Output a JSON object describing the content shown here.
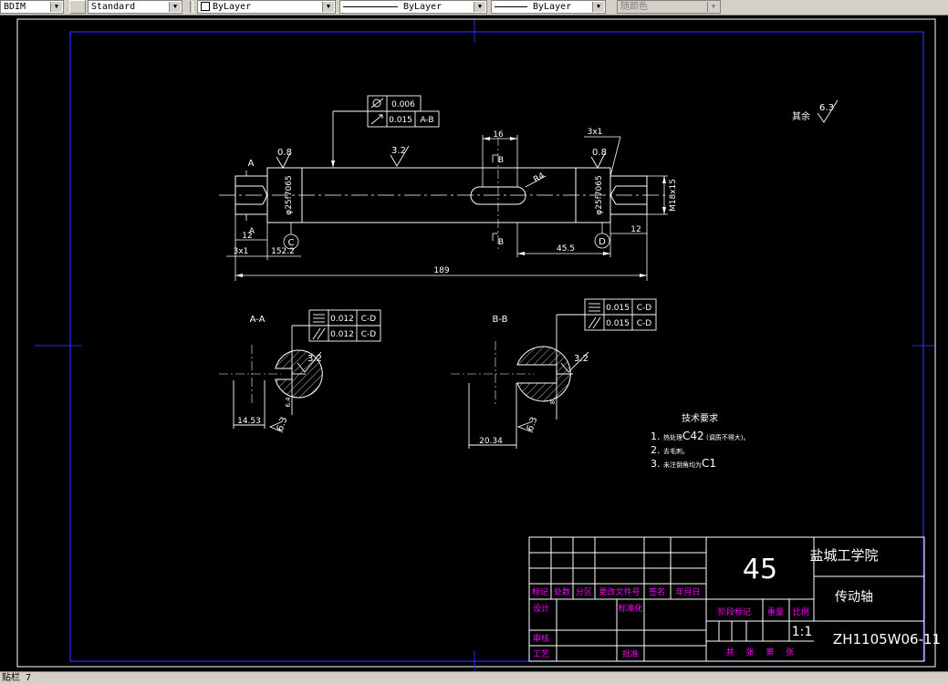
{
  "toolbar": {
    "dimstyle": "BDIM",
    "textstyle": "Standard",
    "layer": "ByLayer",
    "linetype": "ByLayer",
    "lineweight": "ByLayer",
    "color": "随颜色"
  },
  "drawing": {
    "roughness_other": "其余",
    "roughness_other_value": "6.3",
    "gtol": {
      "top_row1": "0.006",
      "top_row2_value": "0.015",
      "top_row2_datum": "A-B",
      "aa_row1_value": "0.012",
      "aa_row1_datum": "C-D",
      "aa_row2_value": "0.012",
      "aa_row2_datum": "C-D",
      "bb_row1_value": "0.015",
      "bb_row1_datum": "C-D",
      "bb_row2_value": "0.015",
      "bb_row2_datum": "C-D"
    },
    "rough": {
      "r1": "0.8",
      "r2": "3.2",
      "r3": "0.8",
      "r4": "3.2",
      "r5": "6.3",
      "r6": "3.2",
      "r7": "6.3"
    },
    "dims": {
      "d16": "16",
      "d3x1_right": "3x1",
      "d3x1_left": "3x1",
      "d12_left": "12",
      "d12_right": "12",
      "d152": "152.2",
      "d455": "45.5",
      "d189": "189",
      "dia_left": "φ25f7065",
      "dia_right": "φ25f7065",
      "m18": "M18x15",
      "r4": "R4",
      "d1453": "14.53",
      "d2034": "20.34",
      "d64": "6.4",
      "d8": "8",
      "aa_depth": "6.3",
      "bb_depth": "8"
    },
    "labels": {
      "A_top": "A",
      "A_bottom": "A",
      "B_top": "B",
      "B_bottom": "B",
      "C": "C",
      "D": "D",
      "section_aa": "A-A",
      "section_bb": "B-B"
    },
    "notes": {
      "title": "技术要求",
      "n1_prefix": "1.",
      "n1_small": "热处理",
      "n1_big": "C42",
      "n1_tail": "(调质不得大)。",
      "n2_prefix": "2.",
      "n2_small": "去毛刺。",
      "n3_prefix": "3.",
      "n3_small": "未注倒角均为",
      "n3_big": "C1"
    }
  },
  "title_block": {
    "material": "45",
    "school": "盐城工学院",
    "part_name": "传动轴",
    "drawing_no": "ZH1105W06-11",
    "scale": "1:1",
    "headers": [
      "标记",
      "处数",
      "分区",
      "更改文件号",
      "签名",
      "年月日"
    ],
    "design": "设计",
    "standardize": "标准化",
    "stage_mark": "阶段标记",
    "weight": "重量",
    "ratio": "比例",
    "review": "审核",
    "process": "工艺",
    "approve": "批准",
    "sheets": "共 张 第 张"
  },
  "status_bar": {
    "text": "贴栏 7"
  }
}
